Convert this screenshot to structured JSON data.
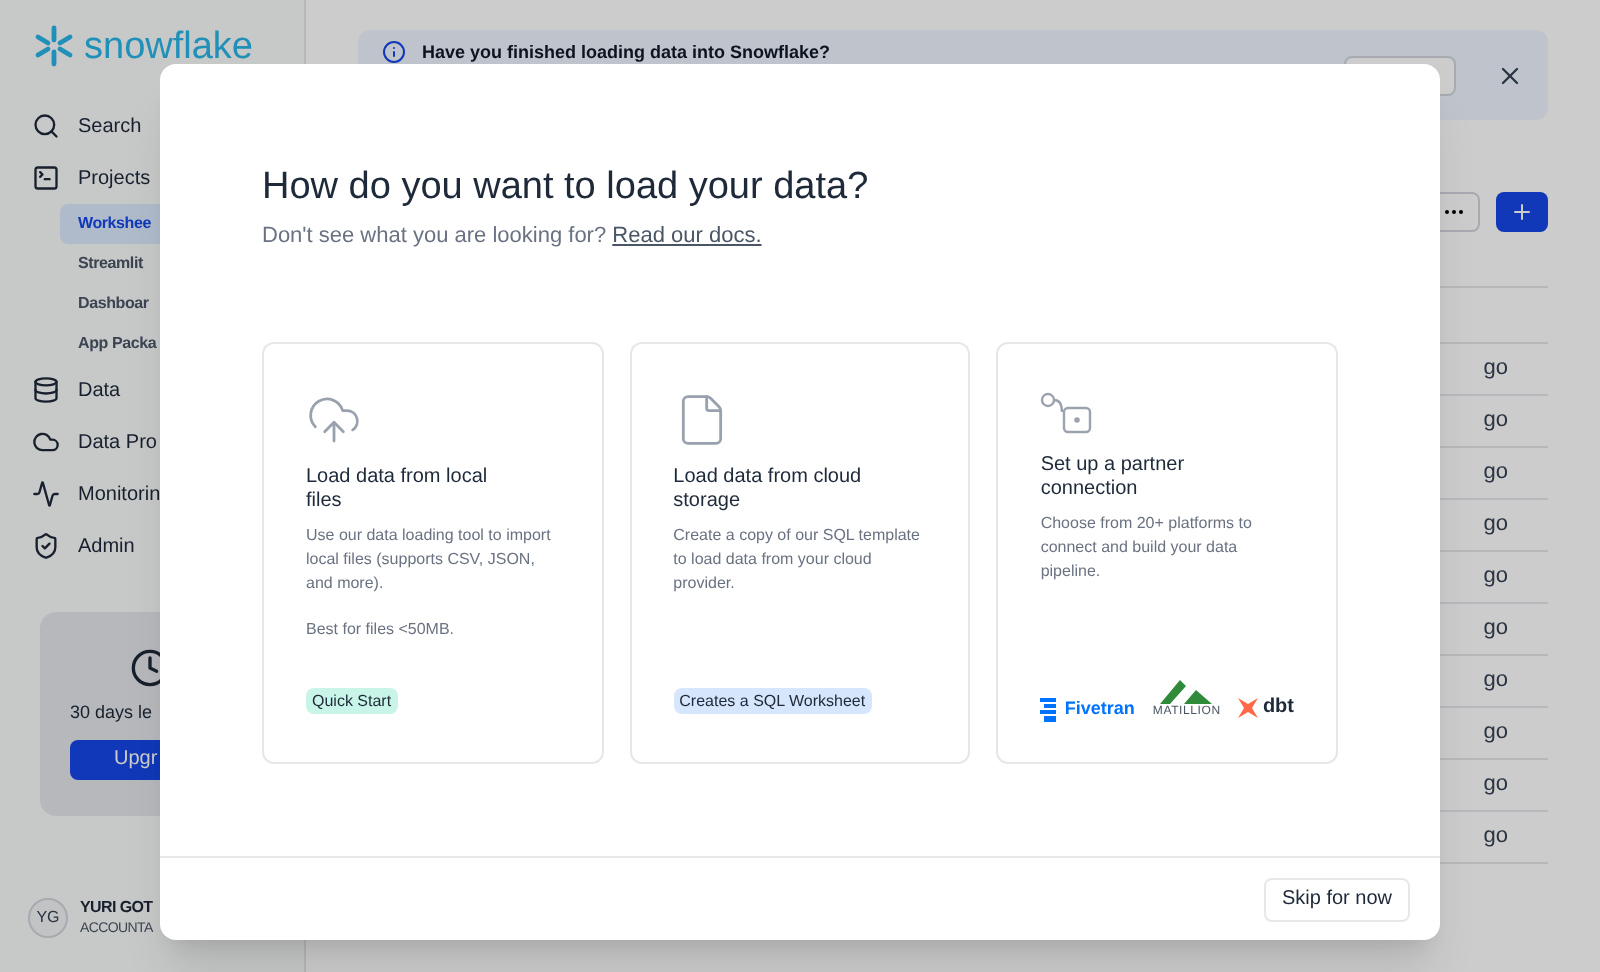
{
  "sidebar": {
    "logo": "snowflake",
    "nav": [
      {
        "kind": "search",
        "label": "Search",
        "selected": false
      },
      {
        "kind": "projects",
        "label": "Projects",
        "selected": false,
        "children": [
          {
            "label": "Workshee",
            "selected": true
          },
          {
            "label": "Streamlit",
            "selected": false
          },
          {
            "label": "Dashboar",
            "selected": false
          },
          {
            "label": "App Packa",
            "selected": false
          }
        ]
      },
      {
        "kind": "data",
        "label": "Data",
        "selected": false
      },
      {
        "kind": "cloud",
        "label": "Data Pro",
        "selected": false
      },
      {
        "kind": "monitoring",
        "label": "Monitorin",
        "selected": false
      },
      {
        "kind": "admin",
        "label": "Admin",
        "selected": false
      }
    ],
    "trial": {
      "text": "30 days le",
      "button": "Upgr"
    },
    "user": {
      "initials": "YG",
      "name": "YURI GOT",
      "role": "ACCOUNTA"
    }
  },
  "main": {
    "banner": {
      "text": "Have you finished loading data into Snowflake?"
    },
    "rows": [
      "go",
      "go",
      "go",
      "go",
      "go",
      "go",
      "go",
      "go",
      "go",
      "go"
    ]
  },
  "modal": {
    "title": "How do you want to load your data?",
    "subtitle": "Don't see what you are looking for?",
    "link": "Read our docs.",
    "cards": [
      {
        "kind": "upload",
        "title": "Load data from local files",
        "description": [
          "Use our data loading tool to import local files (supports CSV, JSON, and more).",
          "Best for files <50MB."
        ],
        "tag": {
          "label": "Quick Start",
          "color": "#c8f5e8"
        }
      },
      {
        "kind": "file",
        "title": "Load data from cloud storage",
        "description": [
          "Create a copy of our SQL template to load data from your cloud provider."
        ],
        "tag": {
          "label": "Creates a SQL Worksheet",
          "color": "#d6e6fc"
        }
      },
      {
        "kind": "partner",
        "title": "Set up a partner connection",
        "description": [
          "Choose from 20+ platforms to connect and build your data pipeline."
        ],
        "partners": [
          {
            "kind": "fivetran",
            "label": "Fivetran"
          },
          {
            "kind": "matillion",
            "label": "MATILLION"
          },
          {
            "kind": "dbt",
            "label": "dbt"
          }
        ]
      }
    ],
    "footer_button": "Skip for now"
  }
}
